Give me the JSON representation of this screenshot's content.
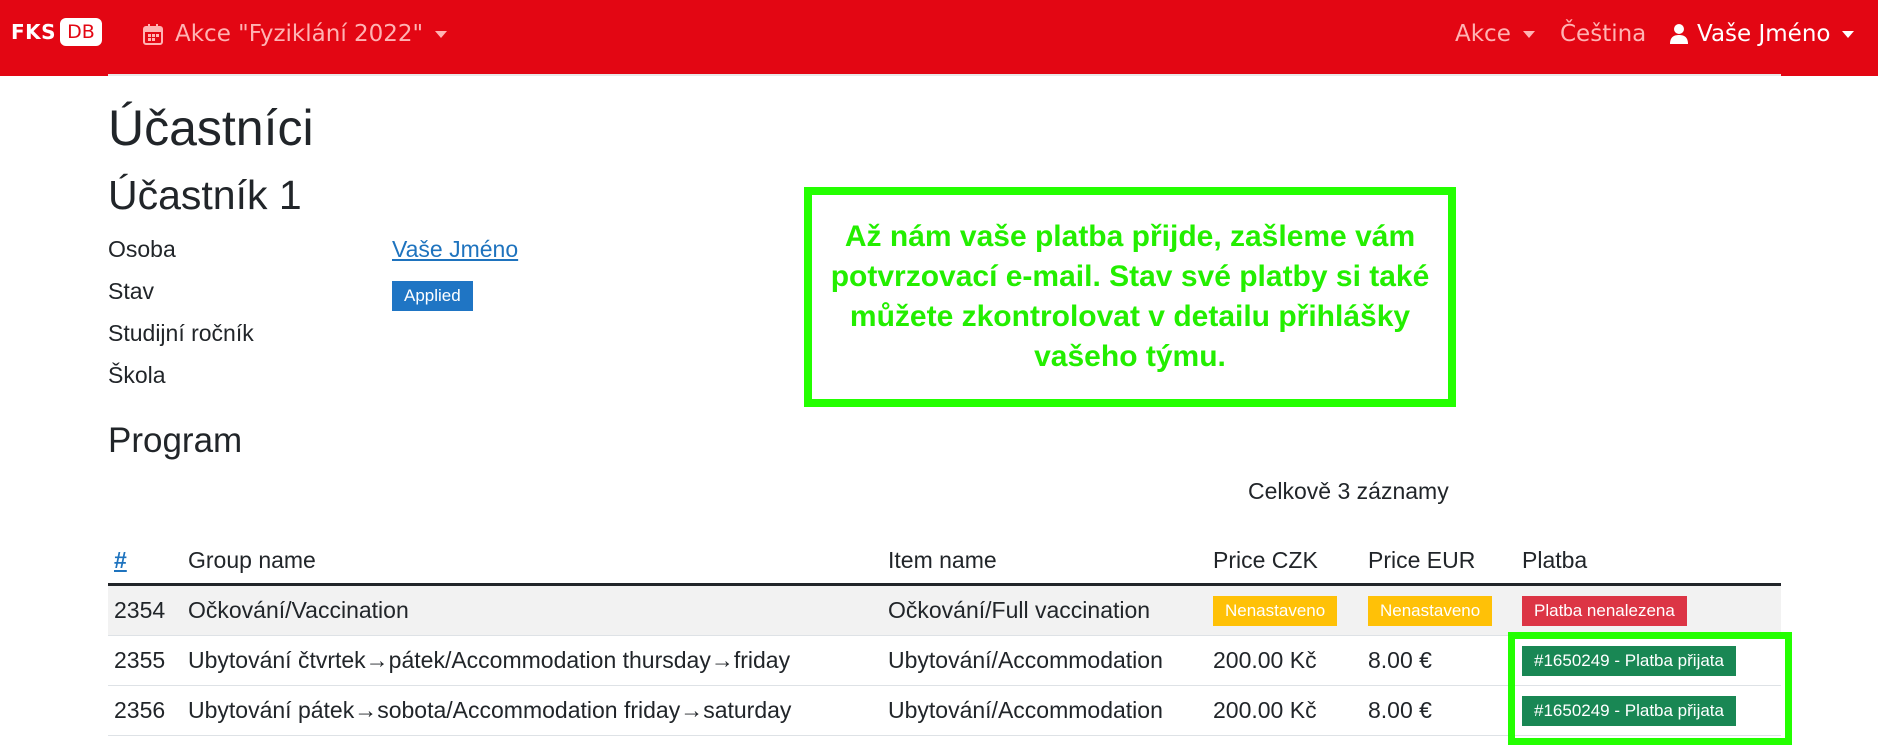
{
  "navbar": {
    "brand_primary": "FKS",
    "brand_secondary": "DB",
    "event_menu": "Akce \"Fyziklání 2022\"",
    "actions_menu": "Akce",
    "language": "Čeština",
    "user_menu": "Vaše Jméno",
    "colors": {
      "background": "#e30613"
    }
  },
  "page": {
    "title": "Účastníci",
    "subtitle": "Účastník 1",
    "details": [
      {
        "label": "Osoba",
        "value": "Vaše Jméno"
      },
      {
        "label": "Stav",
        "value": "Applied"
      },
      {
        "label": "Studijní ročník",
        "value": ""
      },
      {
        "label": "Škola",
        "value": ""
      }
    ],
    "program_heading": "Program",
    "total_records": "Celkově 3 záznamy"
  },
  "callout": {
    "text": "Až nám vaše platba přijde, zašleme vám potvrzovací e-mail. Stav své platby si také můžete zkontrolovat v detailu přihlášky vašeho týmu.",
    "color": "#23ff00"
  },
  "table": {
    "headers": [
      "#",
      "Group name",
      "Item name",
      "Price CZK",
      "Price EUR",
      "Platba"
    ],
    "rows": [
      {
        "id": "2354",
        "group": "Očkování/Vaccination",
        "item": "Očkování/Full vaccination",
        "czk": "Nenastaveno",
        "eur": "Nenastaveno",
        "platba": "Platba nenalezena"
      },
      {
        "id": "2355",
        "group": "Ubytování čtvrtek→pátek/Accommodation thursday→friday",
        "item": "Ubytování/Accommodation",
        "czk": "200.00 Kč",
        "eur": "8.00 €",
        "platba": "#1650249 - Platba přijata"
      },
      {
        "id": "2356",
        "group": "Ubytování pátek→sobota/Accommodation friday→saturday",
        "item": "Ubytování/Accommodation",
        "czk": "200.00 Kč",
        "eur": "8.00 €",
        "platba": "#1650249 - Platba přijata"
      }
    ]
  }
}
